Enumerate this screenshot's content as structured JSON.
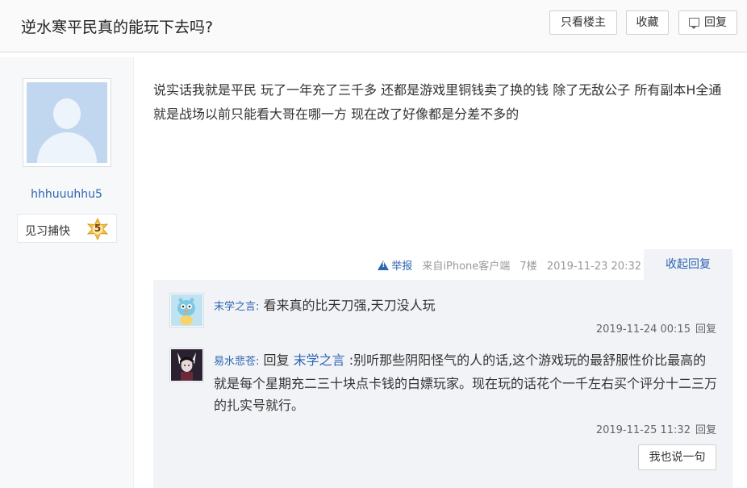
{
  "header": {
    "title": "逆水寒平民真的能玩下去吗?",
    "only_op_label": "只看楼主",
    "favorite_label": "收藏",
    "reply_label": "回复",
    "reply_icon": "speech-bubble-icon"
  },
  "author": {
    "username": "hhhuuuhhu5",
    "level_name": "见习捕快",
    "level": "5",
    "badge_color": "#f2c14e",
    "avatar_color": "#c1d7ef"
  },
  "post": {
    "content": "说实话我就是平民 玩了一年充了三千多 还都是游戏里铜钱卖了换的钱 除了无敌公子 所有副本H全通 就是战场以前只能看大哥在哪一方 现在改了好像都是分差不多的",
    "report_label": "举报",
    "source": "来自iPhone客户端",
    "floor": "7楼",
    "time": "2019-11-23 20:32",
    "collapse_label": "收起回复"
  },
  "comments": [
    {
      "user": "末学之言:",
      "reply_prefix": "",
      "reply_to": "",
      "text": "看来真的比天刀强,天刀没人玩",
      "time": "2019-11-24 00:15",
      "reply_label": "回复"
    },
    {
      "user": "易水悲苍:",
      "reply_prefix": "回复",
      "reply_to": "末学之言",
      "text": ":别听那些阴阳怪气的人的话,这个游戏玩的最舒服性价比最高的就是每个星期充二三十块点卡钱的白嫖玩家。现在玩的话花个一千左右买个评分十二三万的扎实号就行。",
      "time": "2019-11-25 11:32",
      "reply_label": "回复"
    }
  ],
  "say_button_label": "我也说一句",
  "colors": {
    "link": "#2d64b3",
    "lzl_background": "#f1f3f6",
    "sidebar_background": "#f7f8fa"
  }
}
